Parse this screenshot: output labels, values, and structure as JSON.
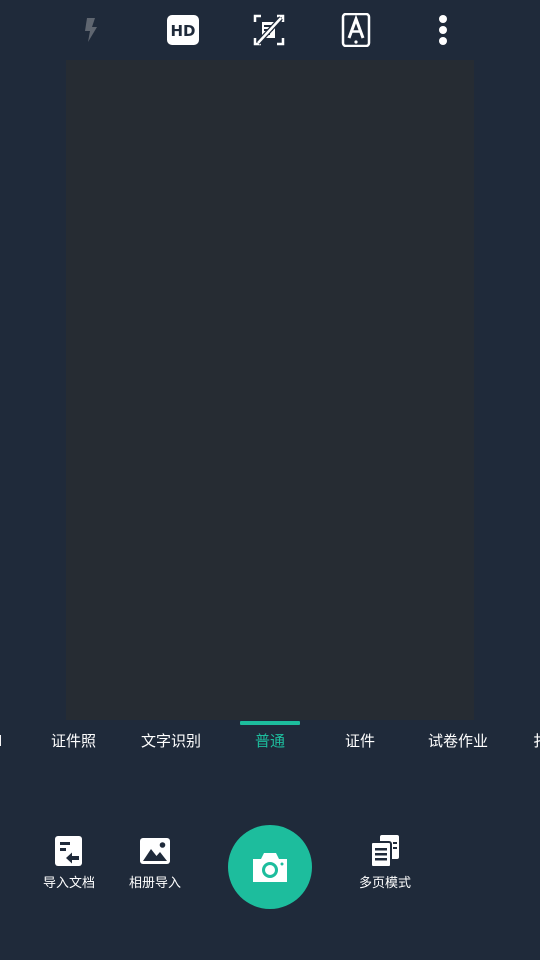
{
  "toolbar": {
    "flash_icon": "flash-off-icon",
    "hd_icon": "hd-icon",
    "crop_off_icon": "crop-off-icon",
    "text_mode_icon": "text-recognition-icon",
    "more_icon": "more-vertical-icon"
  },
  "modes": {
    "active_index": 3,
    "items": [
      {
        "label": "I"
      },
      {
        "label": "证件照"
      },
      {
        "label": "文字识别"
      },
      {
        "label": "普通"
      },
      {
        "label": "证件"
      },
      {
        "label": "试卷作业"
      },
      {
        "label": "扌"
      }
    ]
  },
  "bottom": {
    "import_doc": {
      "label": "导入文档",
      "icon": "import-document-icon"
    },
    "album_import": {
      "label": "相册导入",
      "icon": "image-icon"
    },
    "shutter_icon": "camera-icon",
    "multi_page": {
      "label": "多页模式",
      "icon": "multi-page-icon"
    }
  },
  "colors": {
    "background": "#1f2a3a",
    "viewfinder": "#262c33",
    "accent": "#1dbd9d",
    "text": "#ffffff",
    "disabled": "#5f6670"
  }
}
